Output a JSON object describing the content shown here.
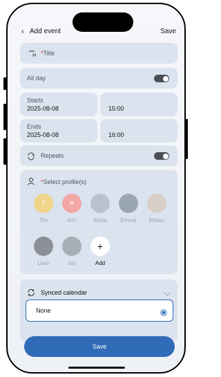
{
  "header": {
    "back_icon": "chevron-left-icon",
    "title": "Add event",
    "save_label": "Save"
  },
  "title_field": {
    "icon": "text-heading-icon",
    "required_mark": "*",
    "placeholder": "Title"
  },
  "all_day": {
    "label": "All day",
    "on": false
  },
  "starts": {
    "label": "Starts",
    "date": "2025-08-08",
    "time": "15:00"
  },
  "ends": {
    "label": "Ends",
    "date": "2025-08-08",
    "time": "16:00"
  },
  "repeats": {
    "icon": "repeat-icon",
    "label": "Repeats",
    "on": false
  },
  "profiles": {
    "icon": "user-icon",
    "required_mark": "*",
    "placeholder": "Select profile(s)",
    "items": [
      {
        "name": "Tim",
        "color": "#f0d48a"
      },
      {
        "name": "kim",
        "color": "#f2a6a6"
      },
      {
        "name": "Aisha",
        "color": "#b9c3cf"
      },
      {
        "name": "Emma",
        "color": "#9aa6b3"
      },
      {
        "name": "Mateo",
        "color": "#d8cfc8"
      },
      {
        "name": "Liam",
        "color": "#8b8f96"
      },
      {
        "name": "Jay",
        "color": "#a8aeb6"
      }
    ],
    "add_label": "Add"
  },
  "synced_calendar": {
    "icon": "sync-icon",
    "label": "Synced calendar",
    "selected": "None",
    "chevron_icon": "chevron-down-icon"
  },
  "footer": {
    "save_label": "Save"
  }
}
